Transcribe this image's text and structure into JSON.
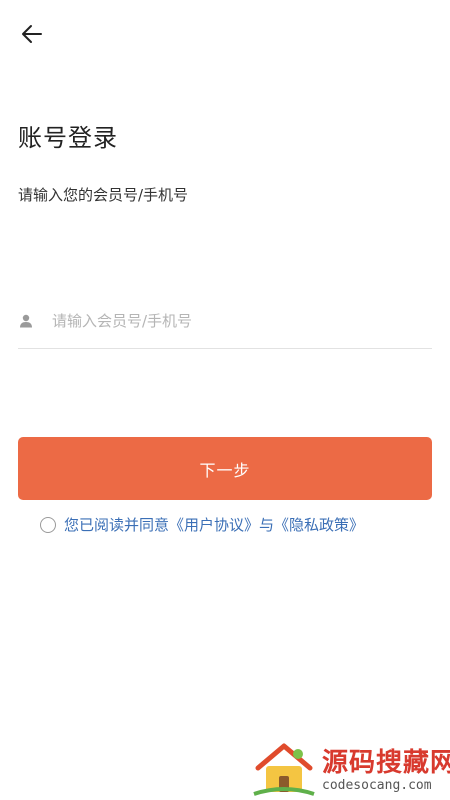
{
  "header": {
    "back_icon": "arrow-left-icon"
  },
  "login": {
    "title": "账号登录",
    "subtitle": "请输入您的会员号/手机号",
    "account_input": {
      "placeholder": "请输入会员号/手机号",
      "value": "",
      "icon": "user-icon"
    },
    "next_button_label": "下一步",
    "agreement": {
      "checked": false,
      "prefix": "您已阅读并同意",
      "user_agreement": "《用户协议》",
      "joiner": "与",
      "privacy_policy": "《隐私政策》"
    }
  },
  "watermark": {
    "title": "源码搜藏网",
    "url": "codesocang.com"
  },
  "colors": {
    "accent": "#ec6a45",
    "link": "#3b6fb6",
    "title_text": "#222222",
    "placeholder": "#b5b5b5"
  }
}
